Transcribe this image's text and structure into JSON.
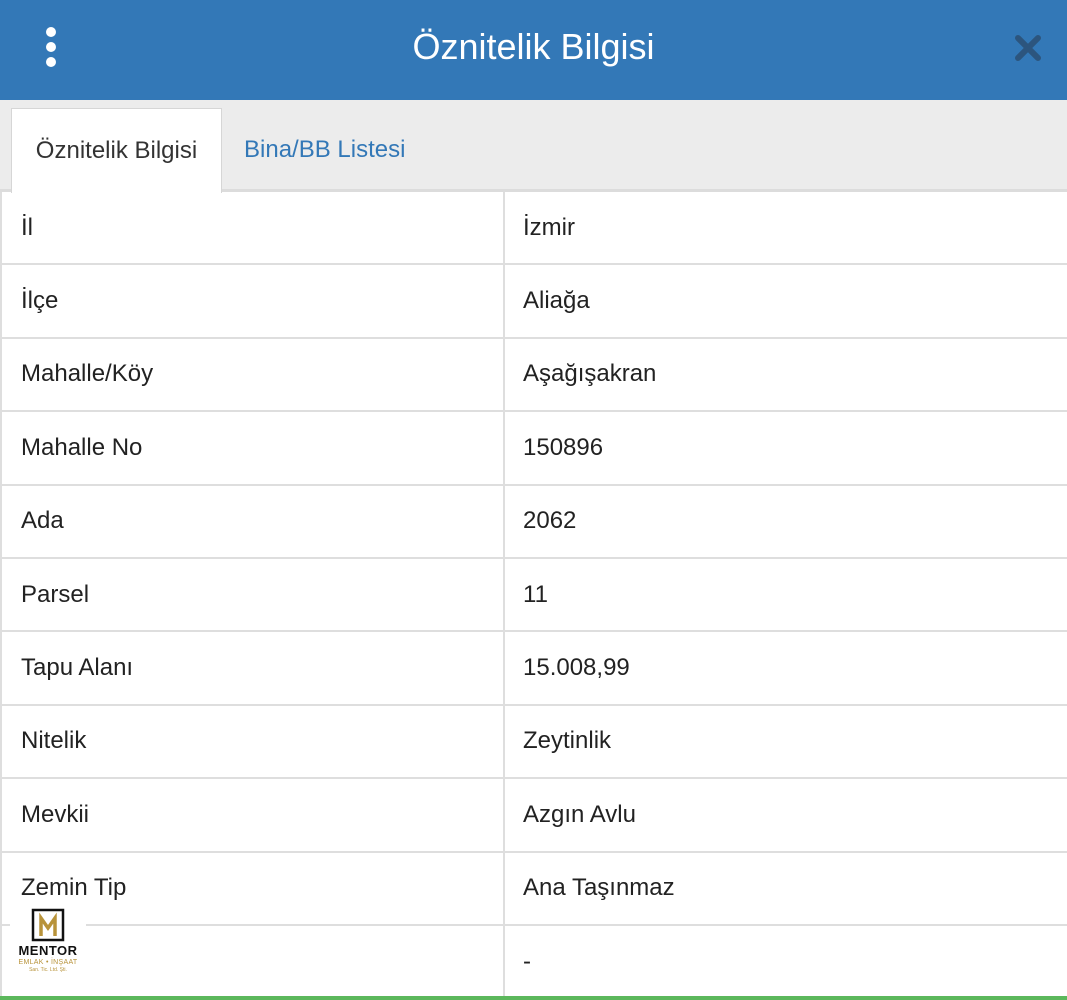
{
  "header": {
    "title": "Öznitelik Bilgisi",
    "menu_icon": "vertical-dots-icon",
    "close_icon": "close-icon",
    "color": "#3378b7"
  },
  "tabs": [
    {
      "label": "Öznitelik Bilgisi",
      "active": true
    },
    {
      "label": "Bina/BB Listesi",
      "active": false
    }
  ],
  "rows": [
    {
      "key": "İl",
      "value": "İzmir"
    },
    {
      "key": "İlçe",
      "value": "Aliağa"
    },
    {
      "key": "Mahalle/Köy",
      "value": "Aşağışakran"
    },
    {
      "key": "Mahalle No",
      "value": "150896"
    },
    {
      "key": "Ada",
      "value": "2062"
    },
    {
      "key": "Parsel",
      "value": "11"
    },
    {
      "key": "Tapu Alanı",
      "value": "15.008,99"
    },
    {
      "key": "Nitelik",
      "value": "Zeytinlik"
    },
    {
      "key": "Mevkii",
      "value": "Azgın Avlu"
    },
    {
      "key": "Zemin Tip",
      "value": "Ana Taşınmaz"
    },
    {
      "key": "",
      "value": "-"
    }
  ],
  "watermark": {
    "name": "MENTOR",
    "subtitle": "EMLAK • İNŞAAT",
    "subtitle2": "San. Tic. Ltd. Şti.",
    "accent": "#b8933a"
  }
}
